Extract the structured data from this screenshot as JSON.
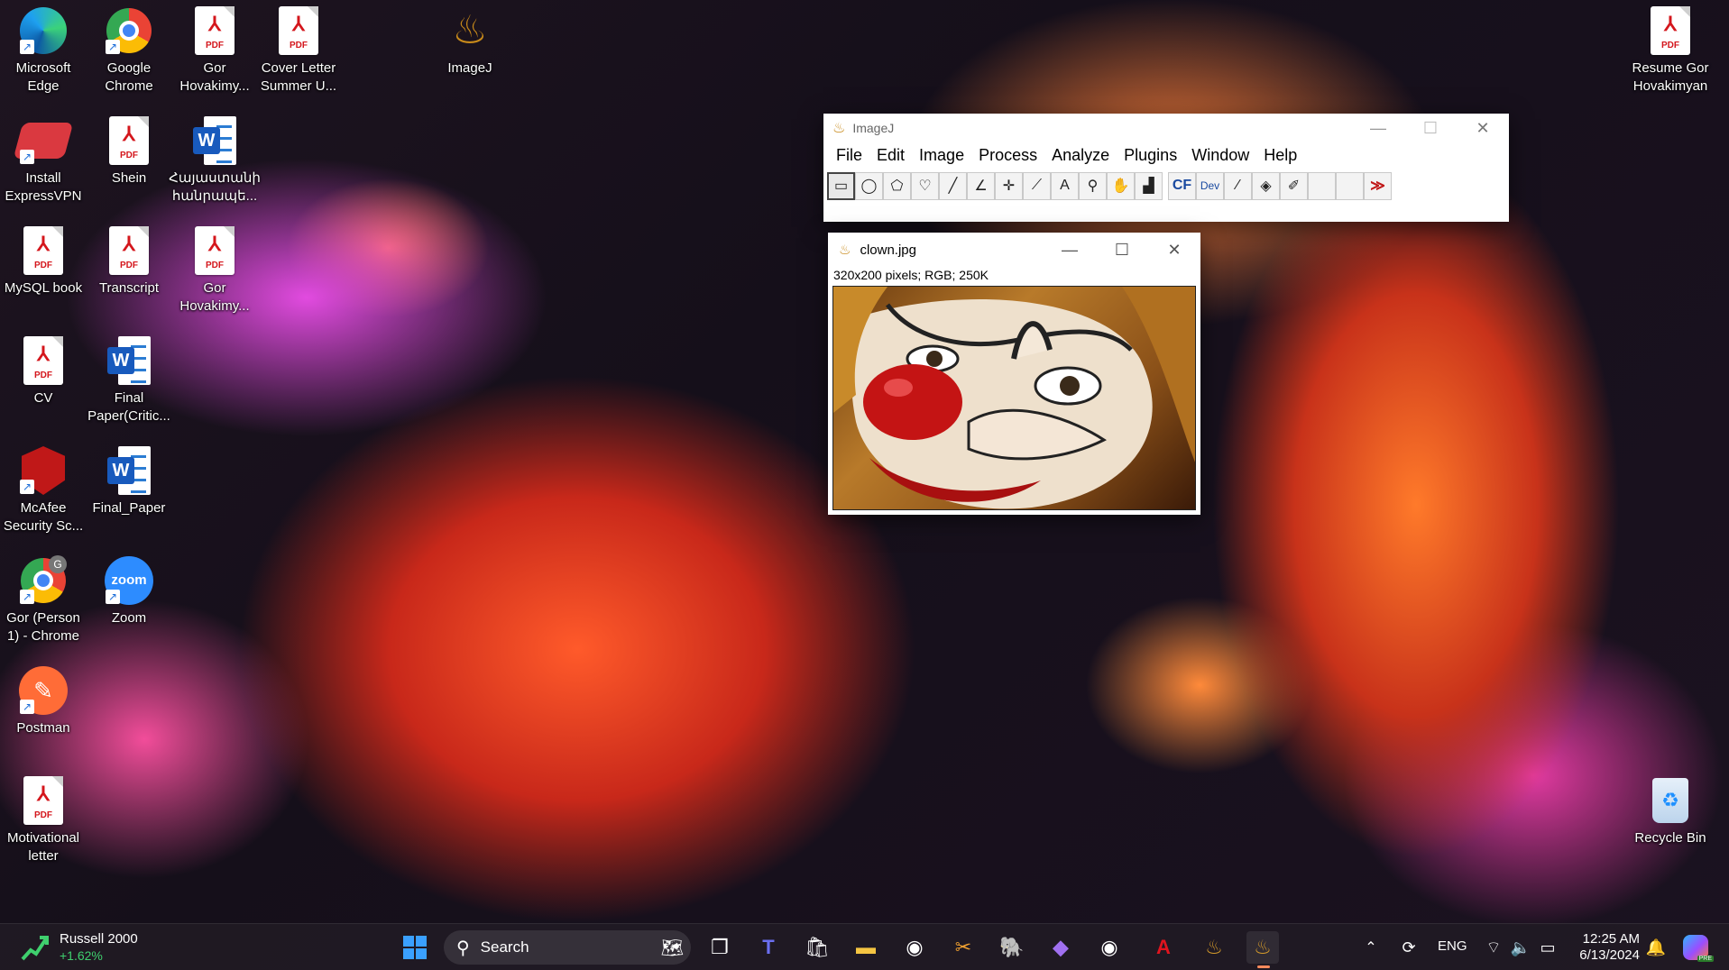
{
  "desktop": {
    "icons": [
      {
        "label": "Microsoft\nEdge",
        "icon": "edge-icon"
      },
      {
        "label": "Google\nChrome",
        "icon": "chrome-icon"
      },
      {
        "label": "Gor\nHovakimy...",
        "icon": "pdf-icon"
      },
      {
        "label": "Cover Letter\nSummer U...",
        "icon": "pdf-icon"
      },
      {
        "label": "ImageJ",
        "icon": "imagej-icon"
      },
      {
        "label": "Resume Gor\nHovakimyan",
        "icon": "pdf-icon"
      },
      {
        "label": "Install\nExpressVPN",
        "icon": "expressvpn-icon"
      },
      {
        "label": "Shein",
        "icon": "pdf-icon"
      },
      {
        "label": "Հայաստանի\nհանրապե...",
        "icon": "word-icon"
      },
      {
        "label": "MySQL book",
        "icon": "pdf-icon"
      },
      {
        "label": "Transcript",
        "icon": "pdf-icon"
      },
      {
        "label": "Gor\nHovakimy...",
        "icon": "pdf-icon"
      },
      {
        "label": "CV",
        "icon": "pdf-icon"
      },
      {
        "label": "Final\nPaper(Critic...",
        "icon": "word-icon"
      },
      {
        "label": "McAfee\nSecurity Sc...",
        "icon": "mcafee-icon"
      },
      {
        "label": "Final_Paper",
        "icon": "word-icon"
      },
      {
        "label": "Gor (Person\n1) - Chrome",
        "icon": "chrome-profile-icon"
      },
      {
        "label": "Zoom",
        "icon": "zoom-icon"
      },
      {
        "label": "Postman",
        "icon": "postman-icon"
      },
      {
        "label": "Motivational\nletter",
        "icon": "pdf-icon"
      },
      {
        "label": "Recycle Bin",
        "icon": "recycle-bin-icon"
      }
    ],
    "pdf_tag": "PDF",
    "word_letter": "W",
    "zoom_text": "zoom",
    "profile_letter": "G"
  },
  "imagej": {
    "title": "ImageJ",
    "menus": [
      "File",
      "Edit",
      "Image",
      "Process",
      "Analyze",
      "Plugins",
      "Window",
      "Help"
    ],
    "tools": [
      "rectangle-tool-icon",
      "oval-tool-icon",
      "polygon-tool-icon",
      "freehand-tool-icon",
      "line-tool-icon",
      "angle-tool-icon",
      "multipoint-tool-icon",
      "wand-tool-icon",
      "text-tool-icon",
      "magnifier-tool-icon",
      "hand-tool-icon",
      "dropper-tool-icon",
      "cf-tool-icon",
      "dev-tool-icon",
      "brush-tool-icon",
      "flood-fill-tool-icon",
      "pencil-tool-icon",
      "empty-slot",
      "empty-slot",
      "more-tools-icon"
    ],
    "cf_label": "CF",
    "dev_label": "Dev"
  },
  "image_window": {
    "title": "clown.jpg",
    "info": "320x200 pixels; RGB; 250K"
  },
  "taskbar": {
    "widget_name": "Russell 2000",
    "widget_change": "+1.62%",
    "search_label": "Search",
    "language": "ENG",
    "time": "12:25 AM",
    "date": "6/13/2024",
    "copilot_badge": "PRE",
    "colors": {
      "up": "#3fcf6e",
      "accent": "#ff8a5c"
    }
  }
}
